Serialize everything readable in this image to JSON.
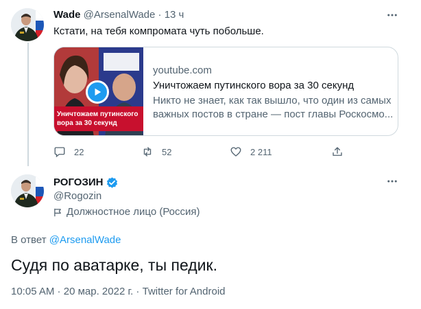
{
  "reply_tweet": {
    "name": "Wade",
    "handle": "@ArsenalWade",
    "separator": " · ",
    "time": "13 ч",
    "text": "Кстати, на тебя компромата чуть побольше.",
    "card": {
      "domain": "youtube.com",
      "title": "Уничтожаем путинского вора за 30 секунд",
      "description_line1": "Никто не знает, как так вышло, что один из самых",
      "description_line2": "важных постов в стране — пост главы Роскосмо...",
      "thumb_caption_line1": "Уничтожаем путинского",
      "thumb_caption_line2": "вора за 30 секунд",
      "thumb_icon": "play-icon"
    },
    "actions": {
      "replies": "22",
      "retweets": "52",
      "likes": "2 211"
    }
  },
  "main_tweet": {
    "name": "РОГОЗИН",
    "handle": "@Rogozin",
    "label": "Должностное лицо (Россия)",
    "reply_prefix": "В ответ",
    "reply_handle": "@ArsenalWade",
    "text": "Судя по аватарке, ты педик.",
    "time": "10:05 AM",
    "date": "20 мар. 2022 г.",
    "source": "Twitter for Android",
    "dot": " · "
  },
  "colors": {
    "accent": "#1d9bf0",
    "text": "#0f1419",
    "muted": "#536471",
    "border": "#cfd9de"
  }
}
